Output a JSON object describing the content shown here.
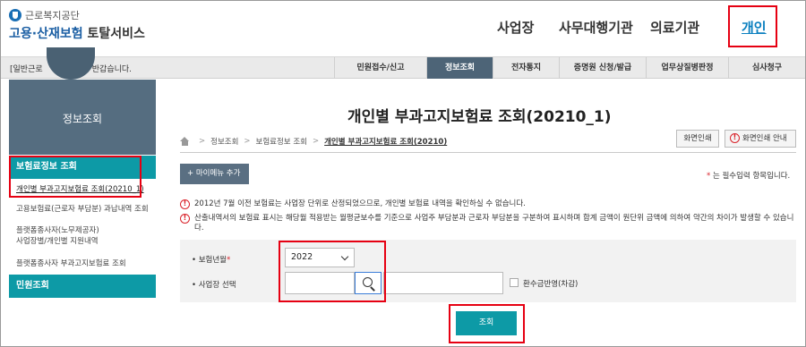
{
  "colors": {
    "accent_teal": "#0d9aa6",
    "nav_active": "#4d6477",
    "highlight_red": "#e60012",
    "link_blue": "#0a7fbf"
  },
  "header": {
    "logo_top": "근로복지공단",
    "logo_main_blue": "고용·산재보험",
    "logo_main_dark": "토탈서비스",
    "logo_icon": "kcomwel-logo-icon",
    "nav": [
      "사업장",
      "사무대행기관",
      "의료기관",
      "개인"
    ],
    "active_nav": "개인"
  },
  "menubar": {
    "welcome_prefix": "[일반근로",
    "welcome_suffix": "님 반갑습니다.",
    "items": [
      "민원접수/신고",
      "정보조회",
      "전자통지",
      "증명원 신청/발급",
      "업무상질병판정",
      "심사청구"
    ],
    "active_item": "정보조회"
  },
  "sidebar": {
    "title": "정보조회",
    "section1": "보험료정보 조회",
    "items": [
      "개인별 부과고지보험료 조회(20210_1)",
      "고용보험료(근로자 부담분) 과납내역 조회",
      "플랫폼종사자(노무제공자)",
      "사업장별/개인별 지원내역",
      "플랫폼종사자 부과고지보험료 조회"
    ],
    "section2": "민원조회"
  },
  "main": {
    "title": "개인별 부과고지보험료 조회(20210_1)",
    "breadcrumb": [
      "정보조회",
      "보험료정보 조회",
      "개인별 부과고지보험료 조회(20210)"
    ],
    "home_icon": "home-icon",
    "print_button": "화면인쇄",
    "print_guide_button": "화면인쇄 안내",
    "mymenu_button": "+ 마이메뉴 추가",
    "required_note_star": "*",
    "required_note": " 는 필수입력 항목입니다.",
    "notices": [
      "2012년 7월 이전 보험료는 사업장 단위로 산정되었으므로, 개인별 보험료 내역을 확인하실 수 없습니다.",
      "산출내역서의 보험료 표시는 해당월 적용받는 월평균보수를 기준으로 사업주 부담분과 근로자 부담분을 구분하여 표시하며 합계 금액이 원단위 금액에 의하여 약간의 차이가 발생할 수 있습니다."
    ]
  },
  "form": {
    "year_label": "보험년월",
    "required_mark": "*",
    "year_value": "2022",
    "workplace_label": "사업장 선택",
    "workplace_value": "",
    "workplace_name": "",
    "refund_checkbox_label": "환수금반영(차감)",
    "refund_checked": false,
    "submit_button": "조회"
  }
}
